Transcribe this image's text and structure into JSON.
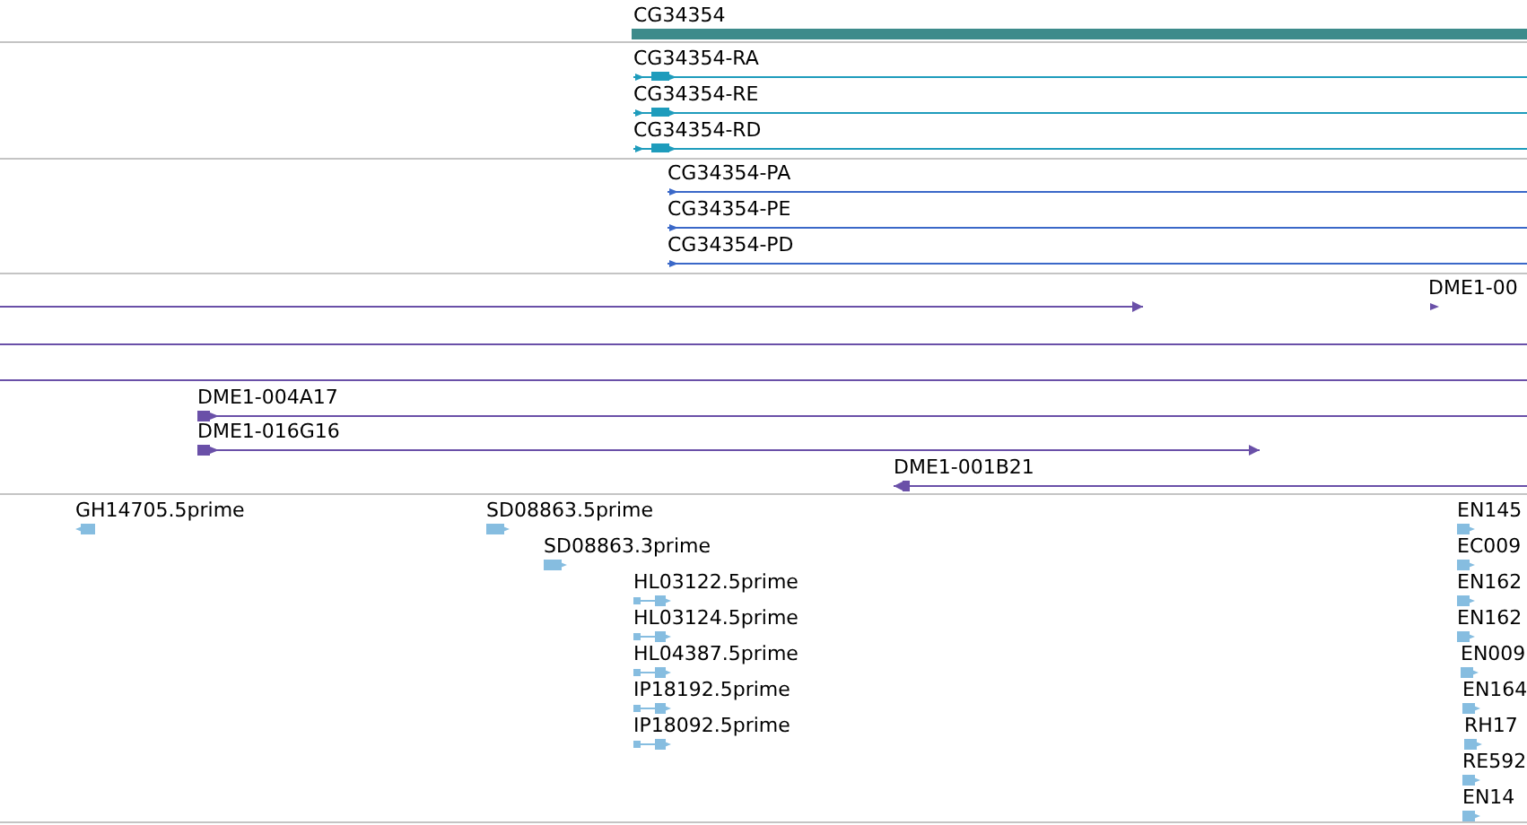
{
  "tracks": [
    {
      "kind": "gene",
      "features": [
        {
          "label": "CG34354"
        }
      ]
    },
    {
      "kind": "transcript",
      "features": [
        {
          "label": "CG34354-RA",
          "reverse": false
        },
        {
          "label": "CG34354-RE",
          "reverse": false
        },
        {
          "label": "CG34354-RD",
          "reverse": false
        }
      ]
    },
    {
      "kind": "protein",
      "features": [
        {
          "label": "CG34354-PA",
          "reverse": false
        },
        {
          "label": "CG34354-PE",
          "reverse": false
        },
        {
          "label": "CG34354-PD",
          "reverse": false
        }
      ]
    },
    {
      "kind": "clone",
      "features": [
        {
          "reverse": false
        },
        {
          "label": "DME1-00",
          "reverse": false
        },
        {
          "arrow": false
        },
        {
          "arrow": false
        },
        {
          "label": "DME1-004A17",
          "reverse": false
        },
        {
          "label": "DME1-016G16",
          "reverse": false
        },
        {
          "label": "DME1-001B21",
          "reverse": true
        }
      ]
    },
    {
      "kind": "est",
      "features": [
        {
          "label": "GH14705.5prime",
          "reverse": true
        },
        {
          "label": "SD08863.5prime",
          "reverse": false
        },
        {
          "label": "SD08863.3prime",
          "reverse": false
        },
        {
          "label": "HL03122.5prime",
          "reverse": false
        },
        {
          "label": "HL03124.5prime",
          "reverse": false
        },
        {
          "label": "HL04387.5prime",
          "reverse": false
        },
        {
          "label": "IP18192.5prime",
          "reverse": false
        },
        {
          "label": "IP18092.5prime",
          "reverse": false
        },
        {
          "label": "EN145",
          "reverse": false
        },
        {
          "label": "EC009",
          "reverse": false
        },
        {
          "label": "EN162",
          "reverse": false
        },
        {
          "label": "EN162",
          "reverse": false
        },
        {
          "label": "EN009",
          "reverse": false
        },
        {
          "label": "EN164",
          "reverse": false
        },
        {
          "label": "RH17",
          "reverse": false
        },
        {
          "label": "RE592",
          "reverse": false
        },
        {
          "label": "EN14",
          "reverse": false
        }
      ]
    }
  ]
}
